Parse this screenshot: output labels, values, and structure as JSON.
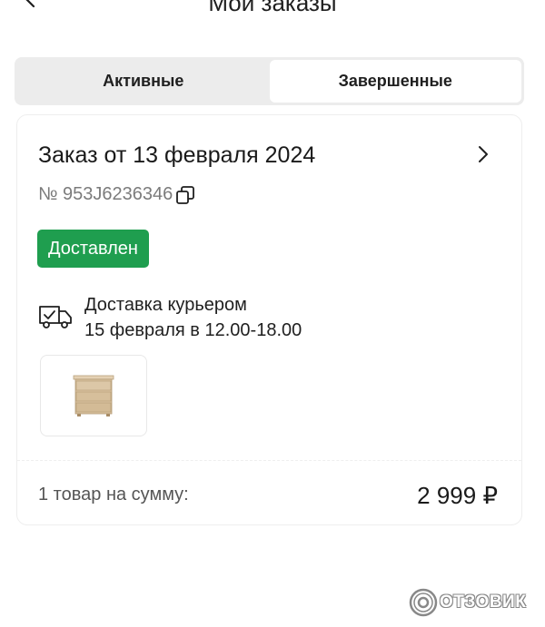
{
  "header": {
    "title": "Мои заказы"
  },
  "tabs": [
    {
      "label": "Активные",
      "active": false
    },
    {
      "label": "Завершенные",
      "active": true
    }
  ],
  "order": {
    "title": "Заказ от 13 февраля 2024",
    "number": "№ 953J6236346",
    "status": "Доставлен",
    "status_color": "#1f9e4f",
    "delivery_method": "Доставка курьером",
    "delivery_time": "15 февраля в 12.00-18.00",
    "product_image": "wooden-dresser",
    "total_label": "1 товар на сумму:",
    "total_value": "2 999 ₽"
  },
  "icons": [
    "back-arrow-icon",
    "chevron-right-icon",
    "copy-icon",
    "delivery-truck-icon"
  ],
  "watermark": {
    "text": "ОТЗОВИК"
  }
}
